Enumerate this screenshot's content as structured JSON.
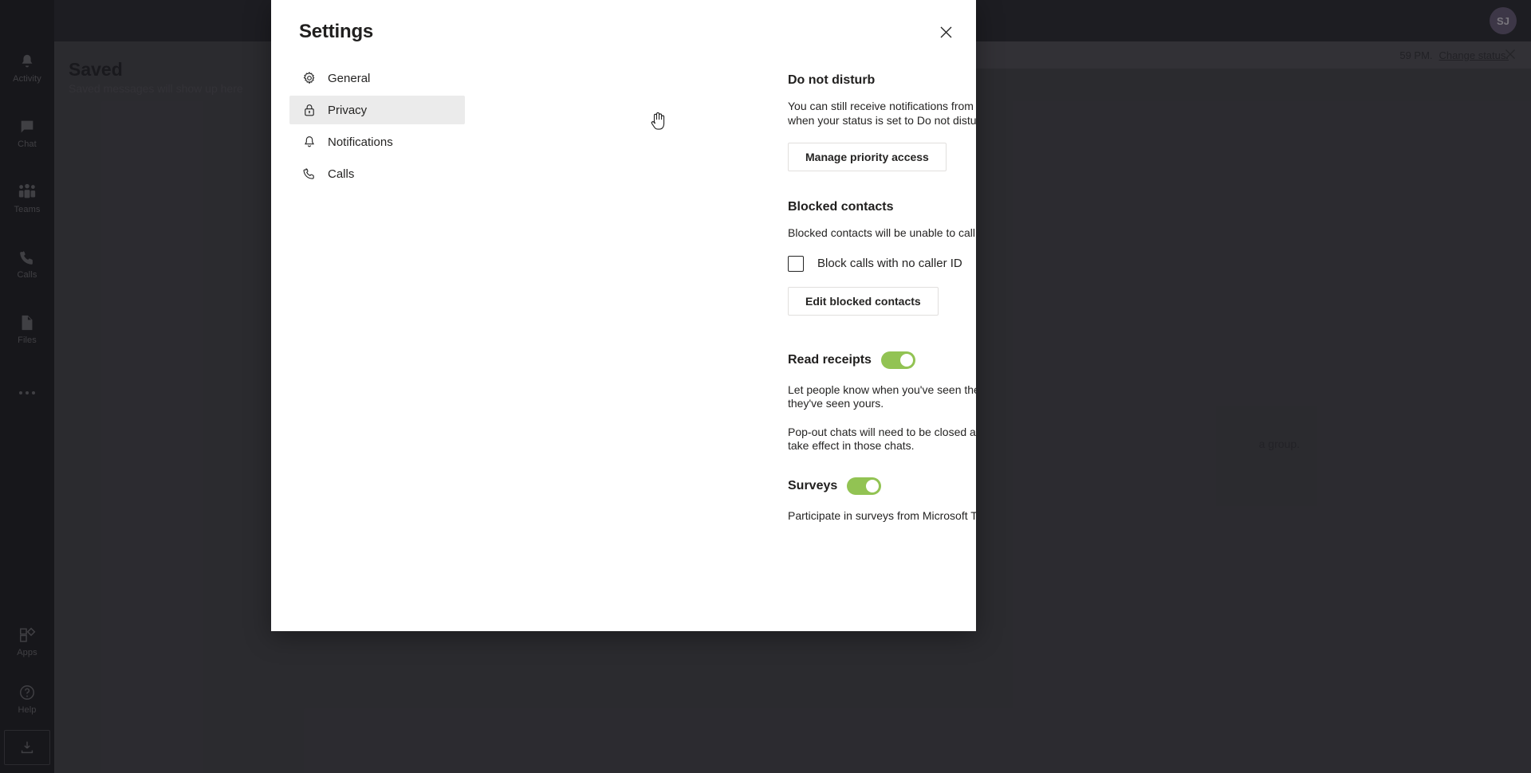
{
  "background": {
    "rail": {
      "items": [
        {
          "label": "Activity",
          "icon": "bell-icon"
        },
        {
          "label": "Chat",
          "icon": "chat-icon"
        },
        {
          "label": "Teams",
          "icon": "teams-icon"
        },
        {
          "label": "Calls",
          "icon": "phone-icon"
        },
        {
          "label": "Files",
          "icon": "file-icon"
        },
        {
          "label": "",
          "icon": "more-icon"
        }
      ],
      "bottom_items": [
        {
          "label": "Apps",
          "icon": "apps-icon"
        },
        {
          "label": "Help",
          "icon": "help-icon"
        }
      ],
      "download_icon": "download-app-icon"
    },
    "avatar_initials": "SJ",
    "saved": {
      "title": "Saved",
      "subtitle": "Saved messages will show up here"
    },
    "status_bar": {
      "text": "59 PM.",
      "link": "Change status.",
      "close_icon": "close-icon"
    },
    "message_fragment": "a group."
  },
  "dialog": {
    "title": "Settings",
    "close_icon": "close-icon",
    "nav": [
      {
        "label": "General",
        "icon": "gear-icon",
        "selected": false
      },
      {
        "label": "Privacy",
        "icon": "lock-icon",
        "selected": true
      },
      {
        "label": "Notifications",
        "icon": "bell-icon",
        "selected": false
      },
      {
        "label": "Calls",
        "icon": "phone-icon",
        "selected": false
      }
    ],
    "privacy": {
      "do_not_disturb": {
        "heading": "Do not disturb",
        "description": "You can still receive notifications from people who have priority access when your status is set to Do not disturb.",
        "button": "Manage priority access"
      },
      "blocked_contacts": {
        "heading": "Blocked contacts",
        "description": "Blocked contacts will be unable to call you or see your presence.",
        "checkbox_label": "Block calls with no caller ID",
        "checkbox_checked": false,
        "button": "Edit blocked contacts"
      },
      "read_receipts": {
        "heading": "Read receipts",
        "toggle_on": true,
        "description_1": "Let people know when you've seen their messages, and know when they've seen yours.",
        "description_2": "Pop-out chats will need to be closed and reopened for this setting to take effect in those chats."
      },
      "surveys": {
        "heading": "Surveys",
        "toggle_on": true,
        "description": "Participate in surveys from Microsoft Teams."
      }
    }
  },
  "colors": {
    "toggle_on": "#92c353",
    "dialog_bg": "#ffffff",
    "nav_selected_bg": "#ebebeb",
    "rail_bg": "#29282f"
  }
}
